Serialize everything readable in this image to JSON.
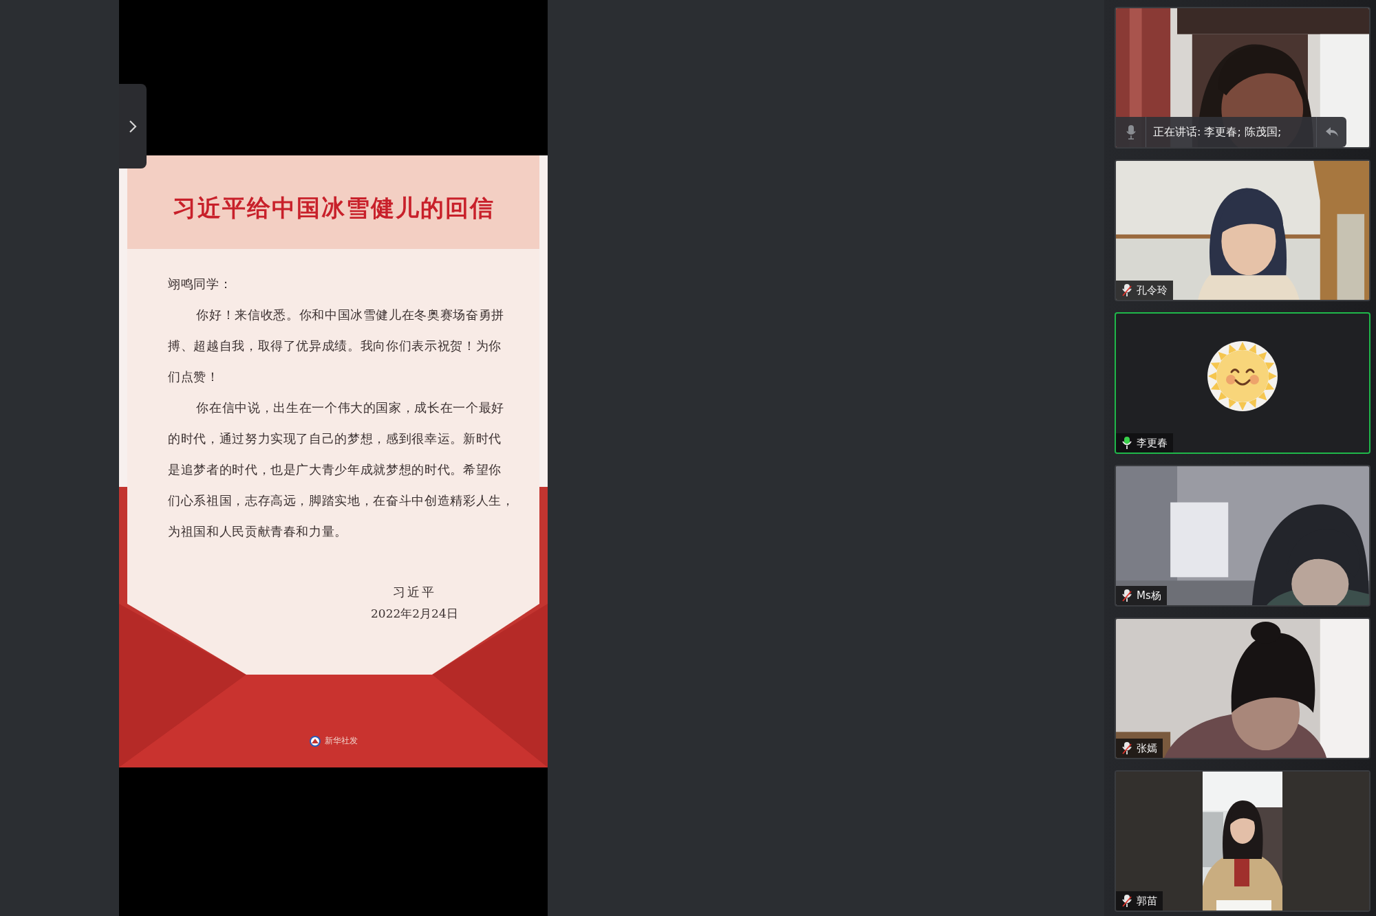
{
  "letter": {
    "title": "习近平给中国冰雪健儿的回信",
    "salutation": "翊鸣同学：",
    "paragraphs": [
      {
        "lines": [
          "你好！来信收悉。你和中国冰雪健儿在冬奥赛场奋勇拼",
          "搏、超越自我，取得了优异成绩。我向你们表示祝贺！为你",
          "们点赞！"
        ]
      },
      {
        "lines": [
          "你在信中说，出生在一个伟大的国家，成长在一个最好",
          "的时代，通过努力实现了自己的梦想，感到很幸运。新时代",
          "是追梦者的时代，也是广大青少年成就梦想的时代。希望你",
          "们心系祖国，志存高远，脚踏实地，在奋斗中创造精彩人生，",
          "为祖国和人民贡献青春和力量。"
        ]
      }
    ],
    "signature": "习近平",
    "date": "2022年2月24日",
    "source": "新华社发"
  },
  "participants": [
    {
      "kind": "video",
      "speaking": false,
      "banner": {
        "text": "正在讲话: 李更春; 陈茂国;"
      }
    },
    {
      "kind": "video",
      "speaking": false,
      "name": "孔令玲",
      "muted": true
    },
    {
      "kind": "avatar",
      "speaking": true,
      "name": "李更春",
      "muted": false
    },
    {
      "kind": "video",
      "speaking": false,
      "name": "Ms杨",
      "muted": true
    },
    {
      "kind": "video",
      "speaking": false,
      "name": "张嫣",
      "muted": true
    },
    {
      "kind": "portrait",
      "speaking": false,
      "name": "郭苗",
      "muted": true
    }
  ]
}
